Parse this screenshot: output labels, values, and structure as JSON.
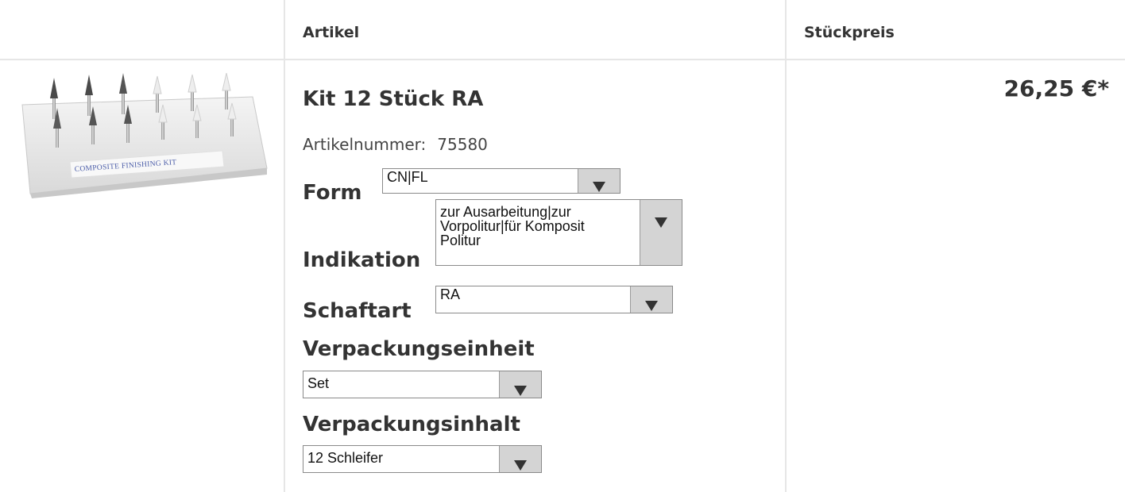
{
  "table": {
    "headers": {
      "artikel": "Artikel",
      "stueckpreis": "Stückpreis"
    }
  },
  "product": {
    "name": "Kit 12 Stück RA",
    "artno_label": "Artikelnummer:",
    "artno_value": "75580",
    "price": "26,25 €*",
    "image_caption": "COMPOSITE FINISHING KIT"
  },
  "options": {
    "form": {
      "label": "Form",
      "value": "CN|FL"
    },
    "indikation": {
      "label": "Indikation",
      "value": "zur Ausarbeitung|zur\nVorpolitur|für Komposit\nPolitur"
    },
    "schaftart": {
      "label": "Schaftart",
      "value": "RA"
    },
    "verpackungseinheit": {
      "label": "Verpackungseinheit",
      "value": "Set"
    },
    "verpackungsinhalt": {
      "label": "Verpackungsinhalt",
      "value": "12 Schleifer"
    }
  },
  "icons": {
    "dropdown": "triangle-down-icon"
  }
}
